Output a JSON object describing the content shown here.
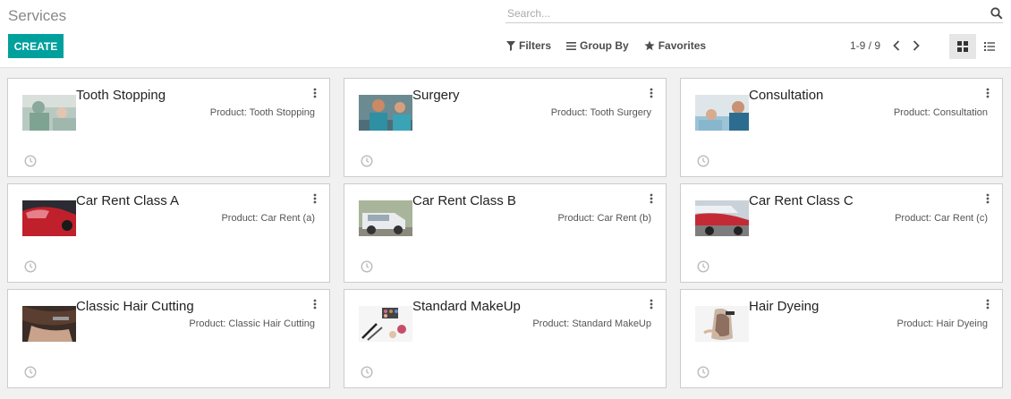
{
  "header": {
    "title": "Services",
    "search_placeholder": "Search...",
    "create_label": "CREATE",
    "filters_label": "Filters",
    "group_by_label": "Group By",
    "favorites_label": "Favorites",
    "pager": "1-9 / 9"
  },
  "cards": [
    {
      "name": "Tooth Stopping",
      "product": "Product: Tooth Stopping",
      "image": "dental-photo"
    },
    {
      "name": "Surgery",
      "product": "Product: Tooth Surgery",
      "image": "surgery-photo"
    },
    {
      "name": "Consultation",
      "product": "Product: Consultation",
      "image": "consultation-photo"
    },
    {
      "name": "Car Rent Class A",
      "product": "Product: Car Rent (a)",
      "image": "red-car-photo"
    },
    {
      "name": "Car Rent Class B",
      "product": "Product: Car Rent (b)",
      "image": "white-suv-photo"
    },
    {
      "name": "Car Rent Class C",
      "product": "Product: Car Rent (c)",
      "image": "cars-lot-photo"
    },
    {
      "name": "Classic Hair Cutting",
      "product": "Product: Classic Hair Cutting",
      "image": "haircut-photo"
    },
    {
      "name": "Standard MakeUp",
      "product": "Product: Standard MakeUp",
      "image": "makeup-photo"
    },
    {
      "name": "Hair Dyeing",
      "product": "Product: Hair Dyeing",
      "image": "hair-dye-photo"
    }
  ],
  "colors": {
    "accent": "#00a09d",
    "background": "#f1f1f1"
  }
}
